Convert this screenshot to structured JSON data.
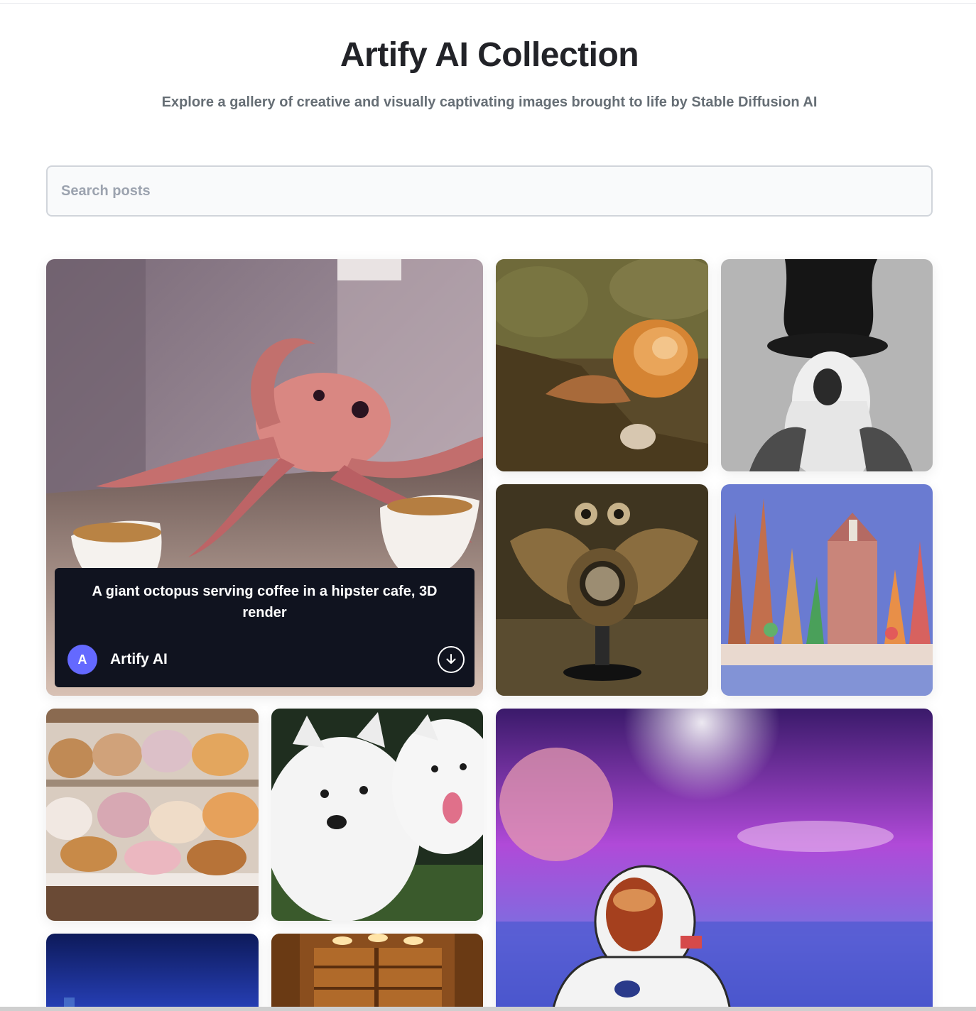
{
  "header": {
    "title": "Artify AI Collection",
    "subtitle": "Explore a gallery of creative and visually captivating images brought to life by Stable Diffusion AI"
  },
  "search": {
    "placeholder": "Search posts",
    "value": ""
  },
  "gallery": {
    "featured": {
      "prompt": "A giant octopus serving coffee in a hipster cafe, 3D render",
      "author": "Artify AI",
      "avatar_initial": "A",
      "download_icon": "download-icon"
    },
    "images": [
      {
        "name": "octopus-cafe-image"
      },
      {
        "name": "snail-image"
      },
      {
        "name": "octopus-gentleman-image"
      },
      {
        "name": "steampunk-owl-image"
      },
      {
        "name": "candy-city-image"
      },
      {
        "name": "animal-pastries-image"
      },
      {
        "name": "samoyed-dogs-image"
      },
      {
        "name": "astronaut-space-image"
      },
      {
        "name": "night-city-image"
      },
      {
        "name": "library-image"
      }
    ]
  },
  "colors": {
    "title": "#222328",
    "subtitle": "#666e75",
    "avatar": "#6469ff",
    "overlay": "#10131f"
  }
}
